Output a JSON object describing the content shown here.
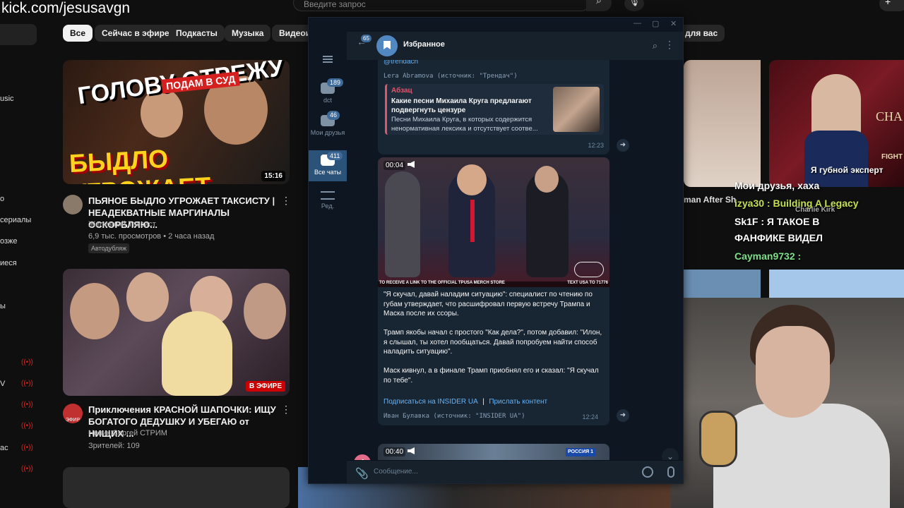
{
  "stream": {
    "url": "kick.com/jesusavgn"
  },
  "youtube": {
    "search_placeholder": "Введите запрос",
    "chips": [
      "Все",
      "Сейчас в эфире",
      "Подкасты",
      "Музыка",
      "Видеои",
      "для вас"
    ],
    "sidebar": [
      "usic",
      "о",
      "сериалы",
      "озже",
      "иеся",
      "ы",
      "V",
      "ас"
    ],
    "video1": {
      "title": "ПЬЯНОЕ БЫДЛО УГРОЖАЕТ ТАКСИСТУ | НЕАДЕКВАТНЫЕ МАРГИНАЛЫ ОСКОРБЛЯЮ...",
      "channel": "Железный Таксист",
      "meta": "6,9 тыс. просмотров • 2 часа назад",
      "badge": "Автодубляж",
      "duration": "15:16",
      "thumb_text_1": "ГОЛОВУ ОТРЕЖУ",
      "thumb_text_2": "ПОДАМ В СУД",
      "thumb_text_3": "БЫДЛО УГРОЖАЕТ"
    },
    "video2": {
      "title": "Приключения КРАСНОЙ ШАПОЧКИ: ИЩУ БОГАТОГО ДЕДУШКУ И УБЕГАЮ от НИЩИХ ...",
      "channel": "Новик Сергей СТРИМ",
      "meta": "Зрителей: 109",
      "badge": "В ЭФИРЕ",
      "avatar_label": "ЭФИР"
    },
    "right_title": "man After Sh",
    "right_thumb_text": "CHA",
    "right_thumb_text2": "FIGHT"
  },
  "stream_chat": [
    "Мои друзья, хаха",
    "izya30 : Building A Legacy",
    "Sk1F : Я ТАКОЕ В",
    "ФАНФИКЕ ВИДЕЛ",
    "Cayman9732 :",
    "Я губной эксперт",
    "Charlie Kirk"
  ],
  "telegram": {
    "back_badge": "65",
    "chat_title": "Избранное",
    "rail": [
      {
        "label": "dct",
        "badge": "189"
      },
      {
        "label": "Мои друзья",
        "badge": "46"
      },
      {
        "label": "Все чаты",
        "badge": "411"
      },
      {
        "label": "Ред.",
        "badge": ""
      }
    ],
    "msg1": {
      "top_link": "@trendach",
      "forward": "Lera Abramova (источник: \"Трендач\")",
      "quote_source": "Абзац",
      "quote_title": "Какие песни Михаила Круга предлагают подвергнуть цензуре",
      "quote_text": "Песни Михаила Круга, в которых содержится ненормативная лексика и отсутствует соотве...",
      "time": "12:23"
    },
    "msg2": {
      "video_time": "00:04",
      "p1": "\"Я скучал, давай наладим ситуацию\": специалист по чтению по губам утверждает, что расшифровал первую встречу Трампа и Маска после их ссоры.",
      "p2": "Трамп якобы начал с простого \"Как дела?\", потом добавил: \"Илон, я слышал, ты хотел пообщаться. Давай попробуем найти способ наладить ситуацию\".",
      "p3": "Маск кивнул, а в финале Трамп приобнял его и сказал: \"Я скучал по тебе\".",
      "link1": "Подписаться на INSIDER UA",
      "separator": "|",
      "link2": "Прислать контент",
      "forward": "Иван Булавка (источник: \"INSIDER UA\")",
      "time": "12:24",
      "caption_left": "TO RECEIVE A LINK TO THE OFFICIAL TPUSA MERCH STORE",
      "caption_right": "TEXT USA TO 71776"
    },
    "msg3": {
      "video_time": "00:40",
      "channel_logo": "РОССИЯ 1",
      "avatar_letter": "J"
    },
    "input_placeholder": "Сообщение..."
  },
  "colors": {
    "tg_bg": "#0e1621",
    "tg_bubble": "#182533",
    "tg_accent": "#6ab2f2",
    "yt_bg": "#0f0f0f",
    "live_red": "#cc0000"
  }
}
